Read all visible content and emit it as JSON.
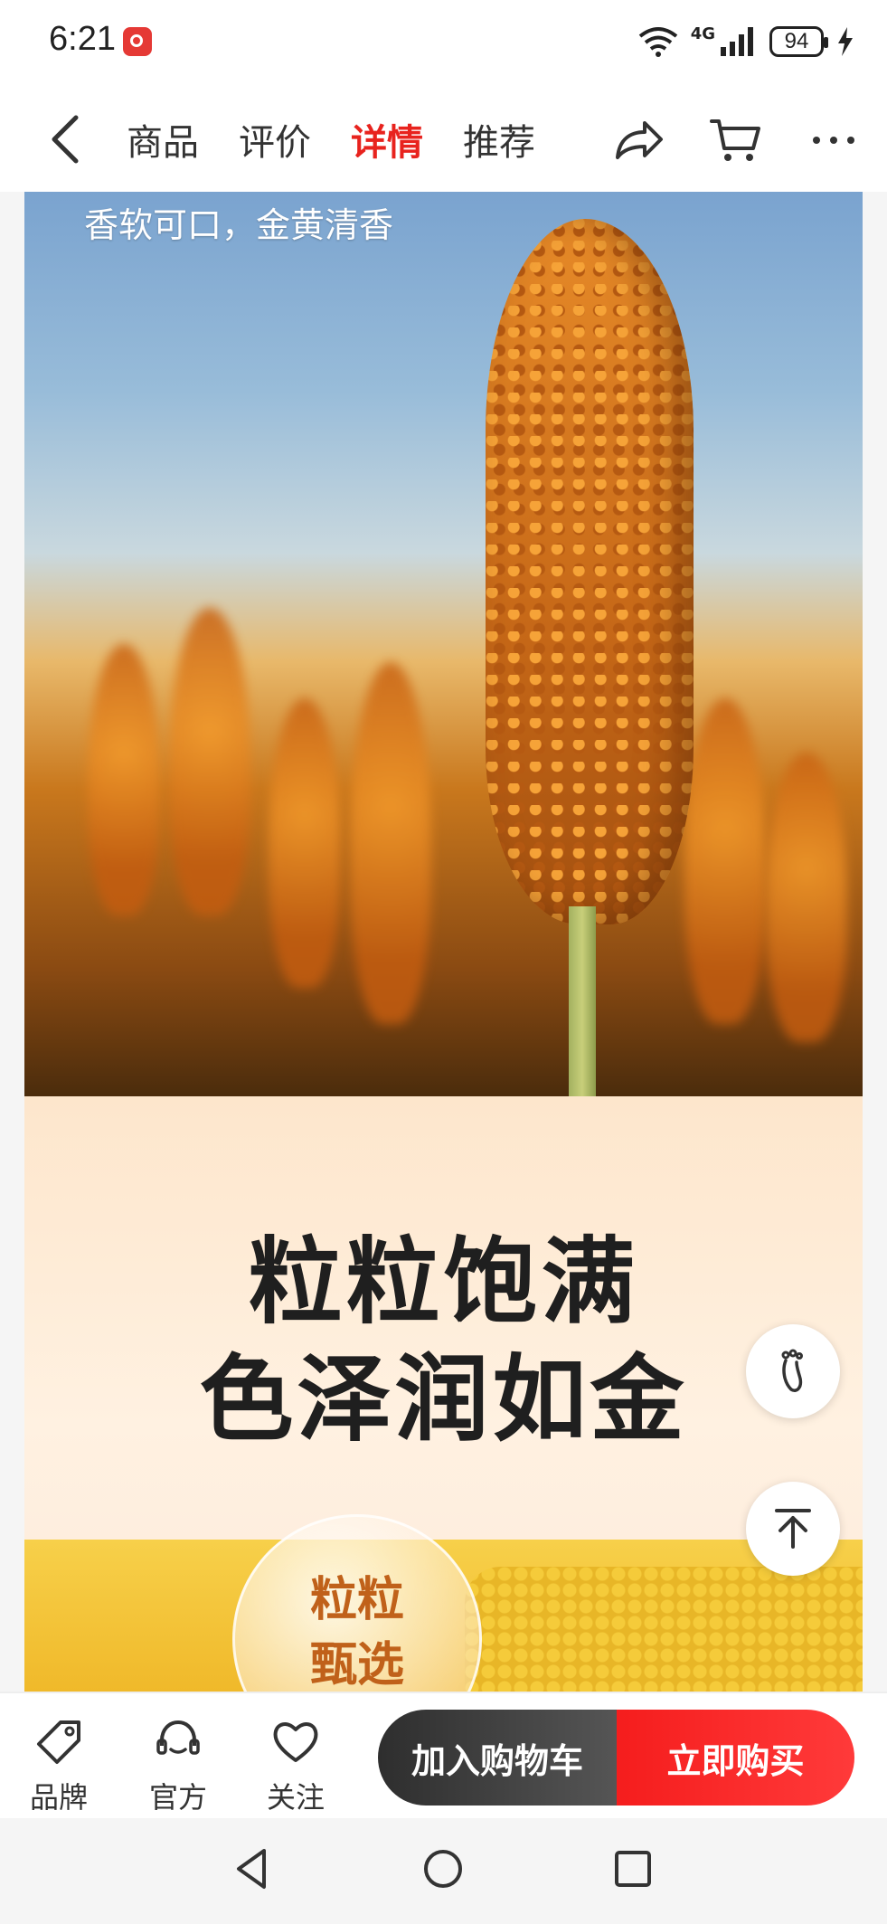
{
  "status_bar": {
    "time": "6:21",
    "network": "4G",
    "battery": "94",
    "icons": [
      "app-notification-icon",
      "wifi-icon",
      "signal-icon",
      "battery-icon",
      "charging-icon"
    ]
  },
  "header": {
    "tabs": [
      {
        "label": "商品",
        "active": false
      },
      {
        "label": "评价",
        "active": false
      },
      {
        "label": "详情",
        "active": true
      },
      {
        "label": "推荐",
        "active": false
      }
    ],
    "icons": [
      "back-icon",
      "share-icon",
      "cart-icon",
      "more-icon"
    ]
  },
  "content": {
    "hero_caption": "香软可口，金黄清香",
    "headline_line1": "粒粒饱满",
    "headline_line2": "色泽润如金",
    "bubble_line1": "粒粒",
    "bubble_line2": "甄选"
  },
  "floating": {
    "icons": [
      "footprint-icon",
      "back-to-top-icon"
    ]
  },
  "bottom_bar": {
    "brand_label": "品牌",
    "official_label": "官方",
    "follow_label": "关注",
    "add_to_cart": "加入购物车",
    "buy_now": "立即购买"
  },
  "colors": {
    "accent_red": "#e8231e",
    "dark_button": "#2e2e2e",
    "buy_button": "#f51d1d"
  }
}
